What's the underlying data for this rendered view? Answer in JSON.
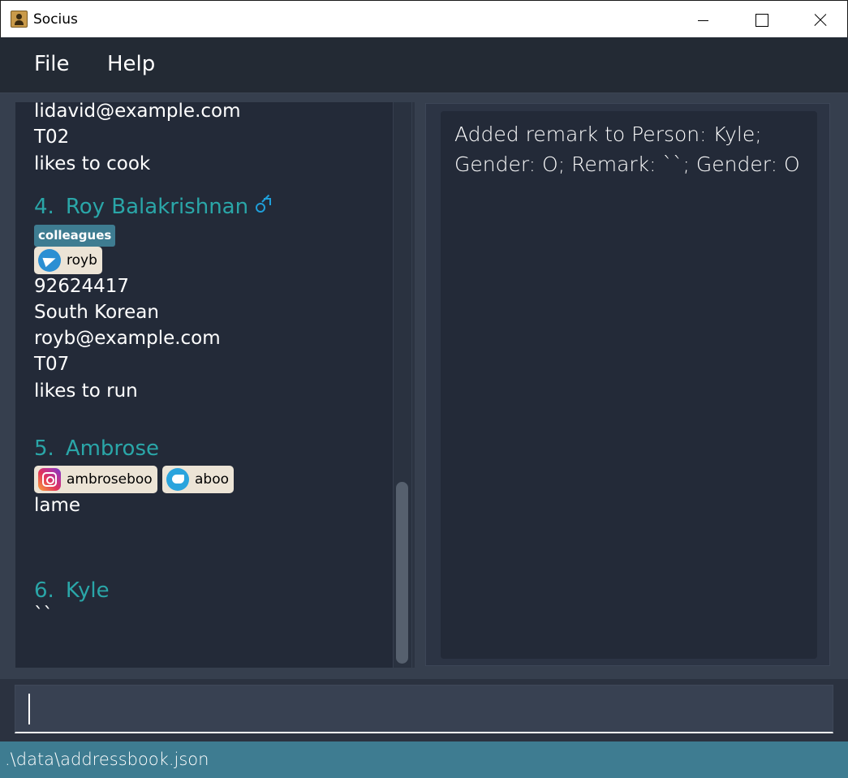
{
  "window": {
    "title": "Socius",
    "icon": "contact-book-icon"
  },
  "menu": {
    "file_label": "File",
    "help_label": "Help"
  },
  "persons": {
    "p3": {
      "email": "lidavid@example.com",
      "tutorial": "T02",
      "remark": "likes to cook"
    },
    "p4": {
      "index": "4.",
      "name": "Roy Balakrishnan",
      "gender_icon": "male-icon",
      "tag": "colleagues",
      "telegram": "royb",
      "phone": "92624417",
      "nationality": "South Korean",
      "email": "royb@example.com",
      "tutorial": "T07",
      "remark": "likes to run"
    },
    "p5": {
      "index": "5.",
      "name": "Ambrose",
      "instagram": "ambroseboo",
      "twitter": "aboo",
      "remark": "lame"
    },
    "p6": {
      "index": "6.",
      "name": "Kyle",
      "remark": "``"
    }
  },
  "result": {
    "line1": "Added remark to Person: Kyle;",
    "line2": "Gender: O; Remark: ``; Gender: O"
  },
  "command": {
    "value": ""
  },
  "status": {
    "file_path": ".\\data\\addressbook.json"
  },
  "colors": {
    "name_accent": "#2aa6a8",
    "tag_bg": "#3e7c91",
    "status_bar": "#3e7c91",
    "panel_bg": "#232a38",
    "menu_bg": "#232a34"
  }
}
